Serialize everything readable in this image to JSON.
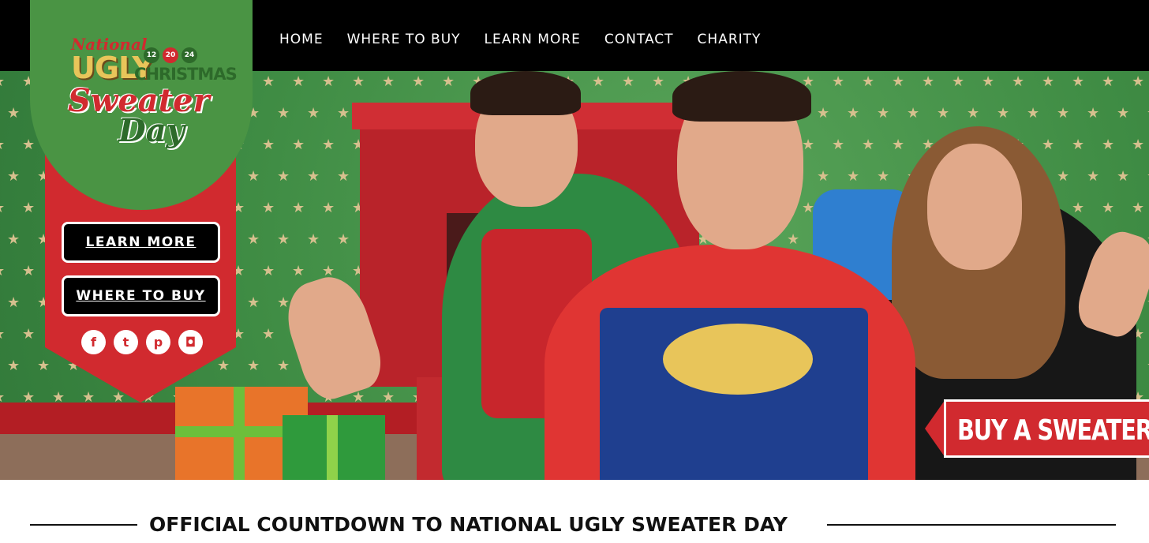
{
  "nav": {
    "items": [
      "HOME",
      "WHERE TO BUY",
      "LEARN MORE",
      "CONTACT",
      "CHARITY"
    ]
  },
  "logo": {
    "national": "National",
    "ugly": "UGLY",
    "christmas": "CHRISTMAS",
    "sweater": "Sweater",
    "day": "Day",
    "dates": [
      "12",
      "20",
      "24"
    ]
  },
  "sidebar": {
    "learn_more_label": "LEARN MORE",
    "where_to_buy_label": "WHERE TO BUY",
    "social": [
      {
        "icon": "facebook-icon",
        "glyph": "f"
      },
      {
        "icon": "twitter-icon",
        "glyph": "t"
      },
      {
        "icon": "pinterest-icon",
        "glyph": "p"
      },
      {
        "icon": "instagram-icon",
        "glyph": "◘"
      }
    ]
  },
  "hero": {
    "buy_label": "BUY A SWEATER"
  },
  "countdown": {
    "title": "OFFICIAL COUNTDOWN TO NATIONAL UGLY SWEATER DAY"
  },
  "colors": {
    "brand_red": "#d12a2f",
    "brand_green": "#4a9444",
    "gold": "#e8c55a",
    "black": "#000000"
  }
}
